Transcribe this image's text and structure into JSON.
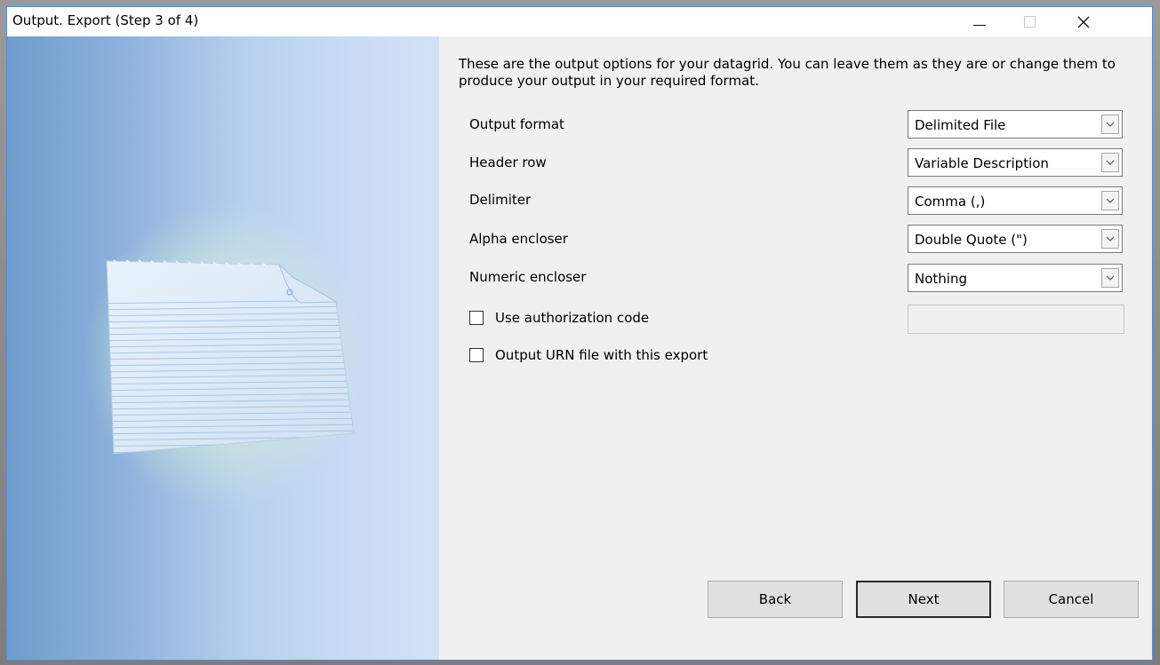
{
  "window": {
    "title": "Output.  Export (Step 3 of 4)"
  },
  "intro_text": "These are the output options for your datagrid.  You can leave them as they are or change them to produce your output in your required format.",
  "fields": [
    {
      "label": "Output format",
      "value": "Delimited File"
    },
    {
      "label": "Header row",
      "value": "Variable Description"
    },
    {
      "label": "Delimiter",
      "value": "Comma (,)"
    },
    {
      "label": "Alpha encloser",
      "value": "Double Quote (\")"
    },
    {
      "label": "Numeric encloser",
      "value": "Nothing"
    }
  ],
  "checkboxes": [
    {
      "label": "Use authorization code",
      "checked": false
    },
    {
      "label": "Output URN file with this export",
      "checked": false
    }
  ],
  "auth_code_value": "",
  "buttons": {
    "back": "Back",
    "next": "Next",
    "cancel": "Cancel"
  },
  "icons": {
    "minimize": "minimize-icon",
    "maximize": "maximize-icon",
    "close": "close-icon",
    "dropdown": "chevron-down-icon",
    "document": "document-page-icon"
  },
  "colors": {
    "window_border": "#5a8ed2",
    "side_panel_left": "#6f9ccc",
    "side_panel_right": "#d2e2f6",
    "dialog_background": "#f0f0f0"
  }
}
